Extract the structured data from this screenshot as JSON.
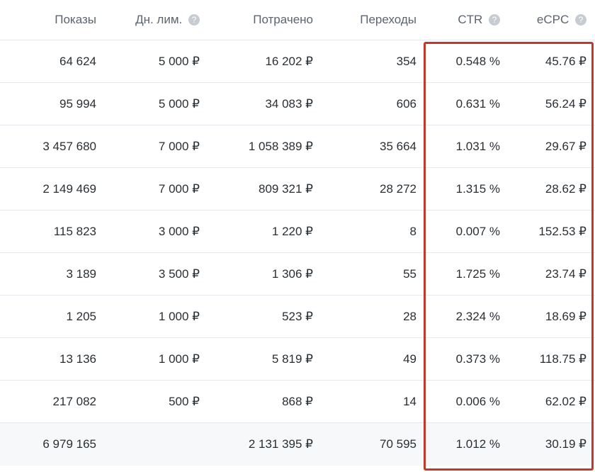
{
  "columns": {
    "impressions": "Показы",
    "daily_limit": "Дн. лим.",
    "spent": "Потрачено",
    "clicks": "Переходы",
    "ctr": "CTR",
    "ecpc": "eCPC"
  },
  "help_glyph": "?",
  "rows": [
    {
      "impressions": "64 624",
      "daily_limit": "5 000 ₽",
      "spent": "16 202 ₽",
      "clicks": "354",
      "ctr": "0.548 %",
      "ecpc": "45.76 ₽"
    },
    {
      "impressions": "95 994",
      "daily_limit": "5 000 ₽",
      "spent": "34 083 ₽",
      "clicks": "606",
      "ctr": "0.631 %",
      "ecpc": "56.24 ₽"
    },
    {
      "impressions": "3 457 680",
      "daily_limit": "7 000 ₽",
      "spent": "1 058 389 ₽",
      "clicks": "35 664",
      "ctr": "1.031 %",
      "ecpc": "29.67 ₽"
    },
    {
      "impressions": "2 149 469",
      "daily_limit": "7 000 ₽",
      "spent": "809 321 ₽",
      "clicks": "28 272",
      "ctr": "1.315 %",
      "ecpc": "28.62 ₽"
    },
    {
      "impressions": "115 823",
      "daily_limit": "3 000 ₽",
      "spent": "1 220 ₽",
      "clicks": "8",
      "ctr": "0.007 %",
      "ecpc": "152.53 ₽"
    },
    {
      "impressions": "3 189",
      "daily_limit": "3 500 ₽",
      "spent": "1 306 ₽",
      "clicks": "55",
      "ctr": "1.725 %",
      "ecpc": "23.74 ₽"
    },
    {
      "impressions": "1 205",
      "daily_limit": "1 000 ₽",
      "spent": "523 ₽",
      "clicks": "28",
      "ctr": "2.324 %",
      "ecpc": "18.69 ₽"
    },
    {
      "impressions": "13 136",
      "daily_limit": "1 000 ₽",
      "spent": "5 819 ₽",
      "clicks": "49",
      "ctr": "0.373 %",
      "ecpc": "118.75 ₽"
    },
    {
      "impressions": "217 082",
      "daily_limit": "500 ₽",
      "spent": "868 ₽",
      "clicks": "14",
      "ctr": "0.006 %",
      "ecpc": "62.02 ₽"
    }
  ],
  "total": {
    "impressions": "6 979 165",
    "daily_limit": "",
    "spent": "2 131 395 ₽",
    "clicks": "70 595",
    "ctr": "1.012 %",
    "ecpc": "30.19 ₽"
  }
}
